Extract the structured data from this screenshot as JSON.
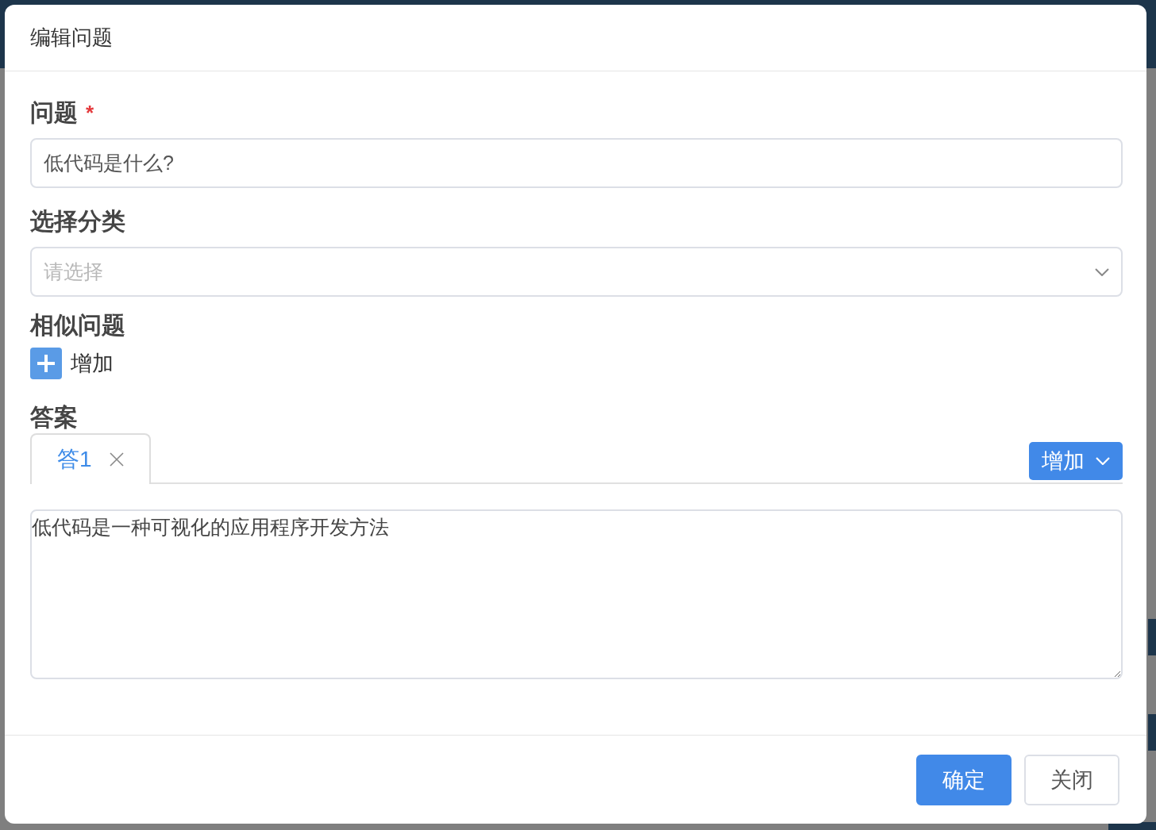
{
  "dialog": {
    "title": "编辑问题"
  },
  "fields": [
    {
      "kind": "text",
      "label": "问题",
      "required_mark": "*",
      "value": "低代码是什么?"
    },
    {
      "kind": "select",
      "label": "选择分类",
      "placeholder": "请选择"
    }
  ],
  "similar": {
    "label": "相似问题",
    "add_label": "增加"
  },
  "answers": {
    "label": "答案",
    "tabs": [
      {
        "label": "答1",
        "selected": true
      }
    ],
    "add_button": "增加",
    "text": "低代码是一种可视化的应用程序开发方法"
  },
  "buttons": [
    {
      "label": "确定",
      "kind": "primary"
    },
    {
      "label": "关闭",
      "kind": "default"
    }
  ]
}
